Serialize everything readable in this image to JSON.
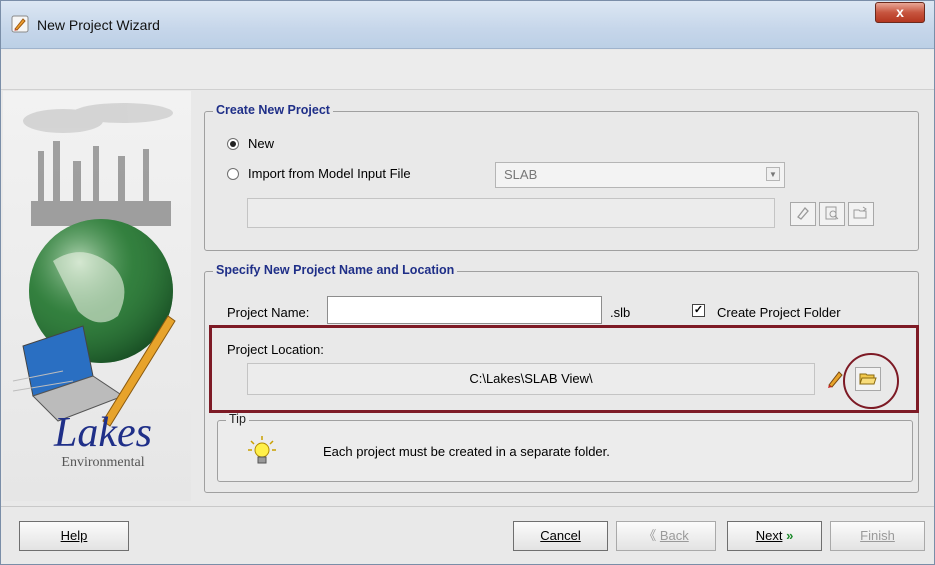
{
  "window": {
    "title": "New Project Wizard",
    "close_glyph": "x"
  },
  "sidebar": {
    "logo_text": "Lakes",
    "logo_subtext": "Environmental"
  },
  "create_group": {
    "legend": "Create New Project",
    "options": [
      {
        "label": "New",
        "checked": true
      },
      {
        "label": "Import from Model Input File",
        "checked": false
      }
    ],
    "model_select": {
      "value": "SLAB"
    },
    "buttons": [
      "eraser-icon",
      "preview-icon",
      "open-folder-icon"
    ]
  },
  "name_group": {
    "legend": "Specify New Project Name and Location",
    "project_name_label": "Project Name:",
    "project_name_value": "",
    "extension": ".slb",
    "create_folder_label": "Create Project Folder",
    "create_folder_checked": true,
    "location_label": "Project Location:",
    "location_value": "C:\\Lakes\\SLAB View\\"
  },
  "tip": {
    "legend": "Tip",
    "text": "Each project must be created in a separate folder."
  },
  "footer": {
    "help": "Help",
    "cancel": "Cancel",
    "back": "Back",
    "next": "Next",
    "finish": "Finish"
  },
  "colors": {
    "accent_legend": "#1f2f88",
    "highlight": "#7d1a25",
    "close_button": "#c7553f"
  }
}
